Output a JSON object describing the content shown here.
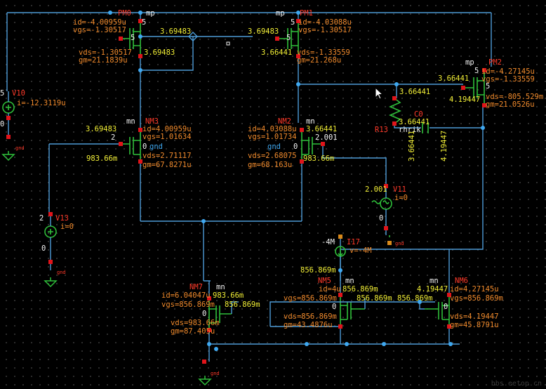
{
  "watermark": "bbs.eetop.cn",
  "labels": {
    "pm0_name": "PM0",
    "pm0_type": "mp",
    "pm0_id": "id=-4.00959u",
    "pm0_vgs": "vgs=-1.30517",
    "pm0_vds": "vds=-1.30517",
    "pm0_gm": "gm=21.1839u",
    "pm0_vg": "3.69483",
    "pm0_vd": "3.69483",
    "pm0_pin5a": "5",
    "pm0_pin5b": "5",
    "pm1_name": "PM1",
    "pm1_type": "mp",
    "pm1_id": "id=-4.03088u",
    "pm1_vgs": "vgs=-1.30517",
    "pm1_vds": "vds=-1.33559",
    "pm1_gm": "gm=21.268u",
    "pm1_vg": "3.69483",
    "pm1_vd": "3.66441",
    "pm1_pin5a": "5",
    "pm1_pin5b": "5",
    "pm2_name": "PM2",
    "pm2_type": "mp",
    "pm2_id": "id=-4.27145u",
    "pm2_vgs": "vgs=-1.33559",
    "pm2_vds": "vds=-805.529m",
    "pm2_gm": "gm=21.0526u",
    "pm2_vg": "3.66441",
    "pm2_vd": "4.19447",
    "pm2_pin5a": "5",
    "pm2_pin5b": "5",
    "nm3_name": "NM3",
    "nm3_type": "mn",
    "nm3_id": "id=4.00959u",
    "nm3_vgs": "vgs=1.01634",
    "nm3_vds": "vds=2.71117",
    "nm3_gm": "gm=67.8271u",
    "nm3_vd": "3.69483",
    "nm3_vg": "2",
    "nm3_vs": "983.66m",
    "nm3_b": "0",
    "nm3_gnd": "gnd",
    "nm2_name": "NM2",
    "nm2_type": "mn",
    "nm2_id": "id=4.03088u",
    "nm2_vgs": "vgs=1.01734",
    "nm2_vds": "vds=2.68075",
    "nm2_gm": "gm=68.163u",
    "nm2_vd": "3.66441",
    "nm2_vg": "2.001",
    "nm2_vs": "983.66m",
    "nm2_b": "0",
    "nm2_gnd": "gnd",
    "v10_name": "V10",
    "v10_i": "i=-12.3119u",
    "v10_top": "5",
    "v10_bot": "0",
    "v10_gnd": "gnd",
    "v13_name": "V13",
    "v13_i": "i=0",
    "v13_top": "2",
    "v13_bot": "0",
    "v13_gnd": "gnd",
    "v11_name": "V11",
    "v11_i": "i=0",
    "v11_top": "2.001",
    "v11_bot": "0",
    "v11_gnd": "gnd",
    "r13_name": "R13",
    "r13_v": "3.66441",
    "c_name": "C0",
    "c_type": "rhrik",
    "c_v1": "3.66441",
    "c_v2": "3.66441",
    "c_v3": "4.19447",
    "i17_name": "I17",
    "i17_v": "v=-4M",
    "i17_top": "-4M",
    "i17_bot": "856.869m",
    "nm7_name": "NM7",
    "nm7_type": "mn",
    "nm7_id": "id=6.04047u",
    "nm7_vgs": "vgs=856.869m",
    "nm7_vds": "vds=983.66m",
    "nm7_gm": "gm=87.405u",
    "nm7_vd": "983.66m",
    "nm7_vg": "856.869m",
    "nm7_b": "0",
    "nm7_gnd": "gnd",
    "nm5_name": "NM5",
    "nm5_type": "mn",
    "nm5_id": "id=4u",
    "nm5_vgs": "vgs=856.869m",
    "nm5_vds": "vds=856.869m",
    "nm5_gm": "gm=43.4876u",
    "nm5_vd": "856.869m",
    "nm5_vg": "856.869m",
    "nm5_b": "0",
    "nm6_name": "NM6",
    "nm6_type": "mn",
    "nm6_id": "id=4.27145u",
    "nm6_vgs": "vgs=856.869m",
    "nm6_vds": "vds=4.19447",
    "nm6_gm": "gm=45.8791u",
    "nm6_vd": "4.19447",
    "nm6_vg": "856.869m",
    "nm6_b": "0"
  }
}
